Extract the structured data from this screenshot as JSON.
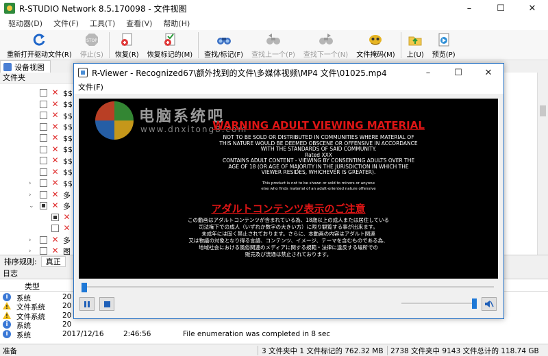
{
  "window": {
    "title": "R-STUDIO Network 8.5.170098 - 文件视图"
  },
  "menu": [
    "驱动器(D)",
    "文件(F)",
    "工具(T)",
    "查看(V)",
    "帮助(H)"
  ],
  "toolbar": [
    {
      "label": "重新打开驱动文件(R)",
      "icon": "refresh-icon",
      "enabled": true
    },
    {
      "label": "停止(S)",
      "icon": "stop-icon",
      "enabled": false
    },
    {
      "label": "恢复(R)",
      "icon": "recover-icon",
      "enabled": true
    },
    {
      "label": "恢复标记的(M)",
      "icon": "recover-marked-icon",
      "enabled": true
    },
    {
      "label": "查找/标记(F)",
      "icon": "find-icon",
      "enabled": true
    },
    {
      "label": "查找上一个(P)",
      "icon": "find-prev-icon",
      "enabled": false
    },
    {
      "label": "查找下一个(N)",
      "icon": "find-next-icon",
      "enabled": false
    },
    {
      "label": "文件掩码(M)",
      "icon": "file-mask-icon",
      "enabled": true
    },
    {
      "label": "上(U)",
      "icon": "up-folder-icon",
      "enabled": true
    },
    {
      "label": "预览(P)",
      "icon": "preview-icon",
      "enabled": true
    }
  ],
  "tabs": {
    "device_view": "设备视图"
  },
  "left_pane": {
    "header": "文件夹",
    "rows": [
      {
        "label": "$$",
        "expand": ""
      },
      {
        "label": "$$",
        "expand": ""
      },
      {
        "label": "$$",
        "expand": ""
      },
      {
        "label": "$$",
        "expand": ""
      },
      {
        "label": "$$",
        "expand": ""
      },
      {
        "label": "$$",
        "expand": ""
      },
      {
        "label": "$$",
        "expand": ""
      },
      {
        "label": "$$",
        "expand": ""
      },
      {
        "label": "$$",
        "expand": "›"
      },
      {
        "label": "多",
        "expand": "›"
      },
      {
        "label": "多",
        "expand": "⌄"
      },
      {
        "label": "",
        "expand": ""
      },
      {
        "label": "",
        "expand": ""
      },
      {
        "label": "多",
        "expand": "›"
      },
      {
        "label": "图",
        "expand": "›"
      }
    ]
  },
  "sortbar": {
    "label": "排序规则:",
    "value": "真正"
  },
  "log": {
    "title": "日志",
    "col_type": "类型",
    "rows": [
      {
        "type": "系统",
        "level": "info",
        "date": "20",
        "time": "",
        "msg": ""
      },
      {
        "type": "文件系统",
        "level": "warn",
        "date": "20",
        "time": "",
        "msg": ""
      },
      {
        "type": "文件系统",
        "level": "warn",
        "date": "20",
        "time": "",
        "msg": ""
      },
      {
        "type": "系统",
        "level": "info",
        "date": "20",
        "time": "",
        "msg": ""
      },
      {
        "type": "系统",
        "level": "info",
        "date": "2017/12/16",
        "time": "2:46:56",
        "msg": "File enumeration was completed in 8 sec"
      }
    ]
  },
  "status": {
    "ready": "准备",
    "marked": "3 文件夹中 1 文件标记的 762.32 MB",
    "total": "2738 文件夹中 9143 文件总计的 118.74 GB"
  },
  "viewer": {
    "title": "R-Viewer - Recognized67\\额外找到的文件\\多媒体视频\\MP4 文件\\01025.mp4",
    "menu_file": "文件(F)",
    "progress": 0.0,
    "volume": 1.0,
    "video": {
      "heading": "WARNING ADULT VIEWING MATERIAL",
      "lines_en": [
        "NOT TO BE SOLD OR DISTRIBUTED IN COMMUNITIES WHERE MATERIAL OF",
        "THIS NATURE WOULD BE DEEMED OBSCENE OR OFFENSIVE IN ACCORDANCE",
        "WITH THE STANDARDS OF SAID COMMUNITY.",
        "Rated XXX",
        "CONTAINS ADULT CONTENT - VIEWING BY CONSENTING ADULTS OVER THE",
        "AGE OF 18 (OR AGE OF MAJORITY IN THE JURISDICTION IN WHICH THE",
        "VIEWER RESIDES, WHICHEVER IS GREATER)."
      ],
      "small_lines": [
        "This product is not to be shown or sold to minors or anyone",
        "else who finds material of an adult-oriented nature offensive"
      ],
      "heading_jp": "アダルトコンテンツ表示のご注意",
      "lines_jp": [
        "この動画はアダルトコンテンツが含まれている為、18歳以上の成人または居住している",
        "司法権下での成人（いずれか数字の大きい方）に限り観覧する事が出来ます。",
        "未成年には固く禁止されております。さらに、本動画の内容はアダルト関連",
        "又は物議の対象となり得る言語、コンテンツ、イメージ、テーマを含むものである為、",
        "地域社会における風俗関連のメディアに関する規範・法律に違反する場所での",
        "販売及び流通は禁止されております。"
      ],
      "watermark_text": "电脑系统吧",
      "watermark_url": "www.dnxitong8.com"
    }
  }
}
